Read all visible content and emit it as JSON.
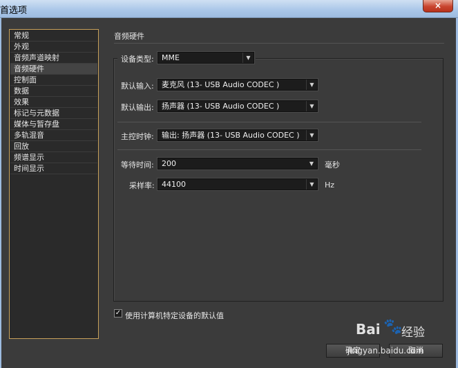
{
  "window": {
    "title": "首选项",
    "close_glyph": "×"
  },
  "nav": {
    "items": [
      {
        "label": "常规"
      },
      {
        "label": "外观"
      },
      {
        "label": "音频声道映射"
      },
      {
        "label": "音频硬件",
        "selected": true
      },
      {
        "label": "控制面"
      },
      {
        "label": "数据"
      },
      {
        "label": "效果"
      },
      {
        "label": "标记与元数据"
      },
      {
        "label": "媒体与暂存盘"
      },
      {
        "label": "多轨混音"
      },
      {
        "label": "回放"
      },
      {
        "label": "频谱显示"
      },
      {
        "label": "时间显示"
      }
    ]
  },
  "panel": {
    "title": "音频硬件",
    "device_type": {
      "label": "设备类型:",
      "value": "MME"
    },
    "default_input": {
      "label": "默认输入:",
      "value": "麦克风 (13- USB Audio CODEC )"
    },
    "default_output": {
      "label": "默认输出:",
      "value": "扬声器 (13- USB Audio CODEC )"
    },
    "master_clock": {
      "label": "主控时钟:",
      "value": "输出: 扬声器 (13- USB Audio CODEC )"
    },
    "latency": {
      "label": "等待时间:",
      "value": "200",
      "unit": "毫秒"
    },
    "sample_rate": {
      "label": "采样率:",
      "value": "44100",
      "unit": "Hz"
    },
    "use_defaults": {
      "label": "使用计算机特定设备的默认值",
      "checked": true,
      "check_glyph": "✓"
    }
  },
  "buttons": {
    "ok": "确定",
    "cancel": "取消"
  },
  "watermark": {
    "logo": "Bai",
    "logo2": "经验",
    "url": "jingyan.baidu.com"
  },
  "colors": {
    "accent_border": "#c8a15a",
    "background": "#3b3b3b",
    "field_bg": "#1c1c1c"
  }
}
